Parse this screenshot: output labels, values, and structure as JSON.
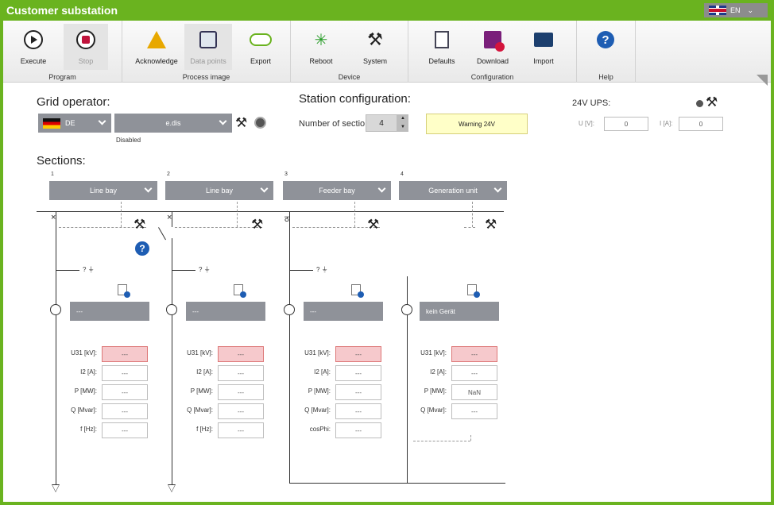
{
  "title": "Customer substation",
  "language": "EN",
  "ribbon": {
    "program": {
      "label": "Program",
      "execute": "Execute",
      "stop": "Stop"
    },
    "process_image": {
      "label": "Process image",
      "acknowledge": "Acknowledge",
      "data_points": "Data points",
      "export": "Export"
    },
    "device": {
      "label": "Device",
      "reboot": "Reboot",
      "system": "System"
    },
    "configuration": {
      "label": "Configuration",
      "defaults": "Defaults",
      "download": "Download",
      "import": "Import"
    },
    "help": {
      "label": "Help"
    }
  },
  "grid_operator": {
    "heading": "Grid operator:",
    "country": "DE",
    "operator": "e.dis",
    "status": "Disabled"
  },
  "station": {
    "heading": "Station configuration:",
    "sections_label": "Number of sectio",
    "sections_value": "4",
    "warning": "Warning 24V"
  },
  "ups": {
    "heading": "24V UPS:",
    "u_label": "U [V]:",
    "u_value": "0",
    "i_label": "I [A]:",
    "i_value": "0"
  },
  "sections_heading": "Sections:",
  "sections": [
    {
      "number": "1",
      "type": "Line bay",
      "device": "---",
      "rows": [
        {
          "label": "U31 [kV]:",
          "value": "---"
        },
        {
          "label": "I2 [A]:",
          "value": "---"
        },
        {
          "label": "P [MW]:",
          "value": "---"
        },
        {
          "label": "Q [Mvar]:",
          "value": "---"
        },
        {
          "label": "f [Hz]:",
          "value": "---"
        }
      ]
    },
    {
      "number": "2",
      "type": "Line bay",
      "device": "---",
      "rows": [
        {
          "label": "U31 [kV]:",
          "value": "---"
        },
        {
          "label": "I2 [A]:",
          "value": "---"
        },
        {
          "label": "P [MW]:",
          "value": "---"
        },
        {
          "label": "Q [Mvar]:",
          "value": "---"
        },
        {
          "label": "f [Hz]:",
          "value": "---"
        }
      ]
    },
    {
      "number": "3",
      "type": "Feeder bay",
      "device": "---",
      "rows": [
        {
          "label": "U31 [kV]:",
          "value": "---"
        },
        {
          "label": "I2 [A]:",
          "value": "---"
        },
        {
          "label": "P [MW]:",
          "value": "---"
        },
        {
          "label": "Q [Mvar]:",
          "value": "---"
        },
        {
          "label": "cosPhi:",
          "value": "---"
        }
      ]
    },
    {
      "number": "4",
      "type": "Generation unit",
      "device": "kein Gerät",
      "rows": [
        {
          "label": "U31 [kV]:",
          "value": "---"
        },
        {
          "label": "I2 [A]:",
          "value": "---"
        },
        {
          "label": "P [MW]:",
          "value": "NaN"
        },
        {
          "label": "Q [Mvar]:",
          "value": "---"
        }
      ]
    }
  ],
  "colors": {
    "accent": "#6ab31f",
    "dropdown": "#8f9299",
    "alarm": "#f6c9cc",
    "warning": "#ffffc8",
    "help": "#1e5db3"
  }
}
